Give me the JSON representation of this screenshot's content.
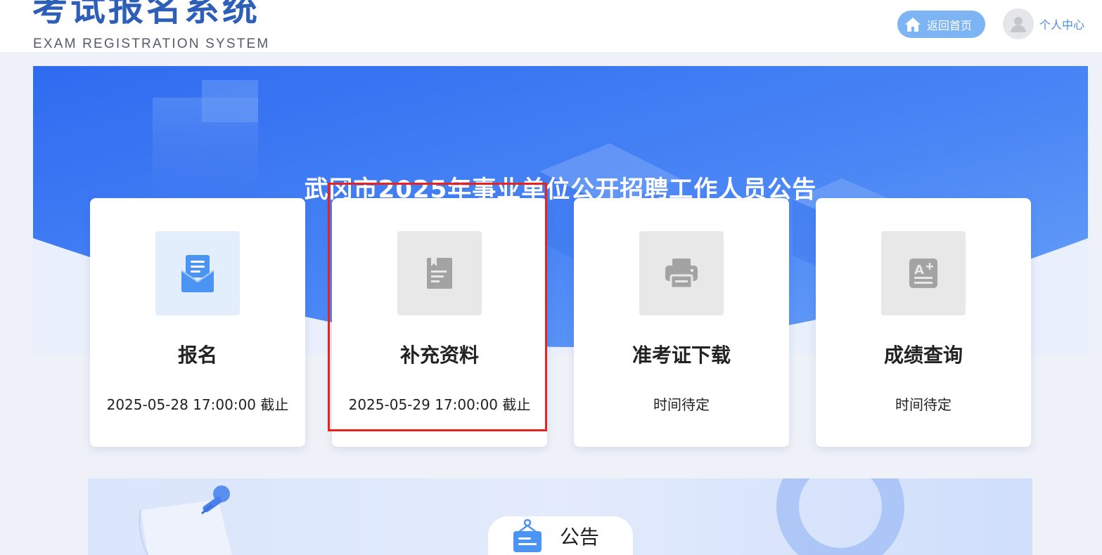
{
  "header": {
    "logo_cn": "考试报名系统",
    "logo_en": "EXAM REGISTRATION SYSTEM",
    "home_label": "返回首页",
    "home_icon": "home-icon",
    "user_label": "个人中心",
    "user_icon": "user-avatar-icon"
  },
  "banner": {
    "title": "武冈市2025年事业单位公开招聘工作人员公告"
  },
  "cards": [
    {
      "title": "报名",
      "subtitle": "2025-05-28 17:00:00 截止",
      "icon": "envelope-icon",
      "active": true
    },
    {
      "title": "补充资料",
      "subtitle": "2025-05-29 17:00:00 截止",
      "icon": "document-icon",
      "active": false
    },
    {
      "title": "准考证下载",
      "subtitle": "时间待定",
      "icon": "printer-icon",
      "active": false
    },
    {
      "title": "成绩查询",
      "subtitle": "时间待定",
      "icon": "grade-icon",
      "active": false
    }
  ],
  "notice": {
    "label": "公告",
    "icon": "notice-board-icon"
  },
  "colors": {
    "brand_blue": "#2d5fb8",
    "banner_blue": "#3f7bf2",
    "highlight_red": "#e5231f",
    "active_icon_bg": "#e3eefd",
    "inactive_icon_bg": "#e8e8e8"
  }
}
